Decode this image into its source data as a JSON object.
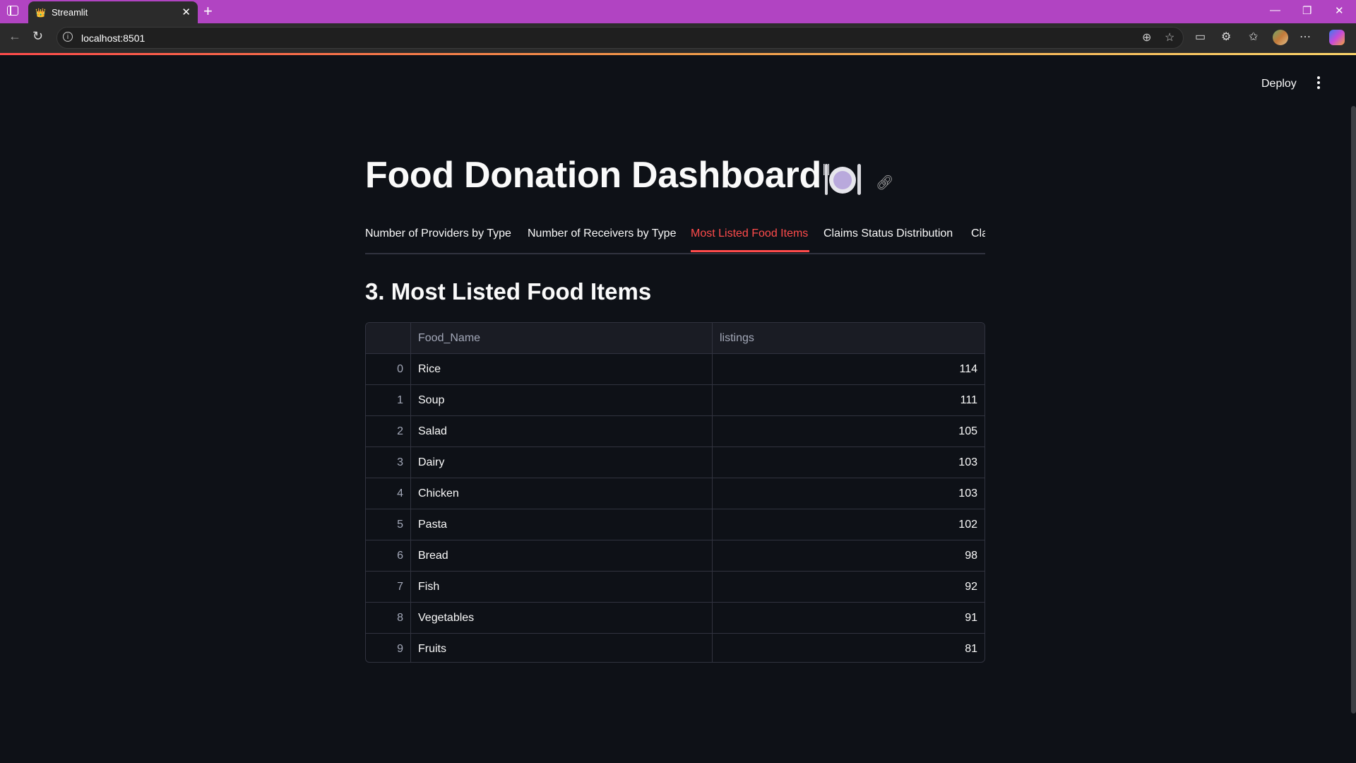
{
  "browser": {
    "tab_title": "Streamlit",
    "address": "localhost:8501"
  },
  "app": {
    "deploy_label": "Deploy",
    "title": "Food Donation Dashboard",
    "title_emoji": "🍽️",
    "tabs": [
      {
        "label": "Number of Providers by Type"
      },
      {
        "label": "Number of Receivers by Type"
      },
      {
        "label": "Most Listed Food Items",
        "active": true
      },
      {
        "label": "Claims Status Distribution"
      },
      {
        "label": "Cla"
      }
    ],
    "section_heading": "3. Most Listed Food Items",
    "table": {
      "columns": [
        "Food_Name",
        "listings"
      ],
      "rows": [
        {
          "index": "0",
          "name": "Rice",
          "listings": "114"
        },
        {
          "index": "1",
          "name": "Soup",
          "listings": "111"
        },
        {
          "index": "2",
          "name": "Salad",
          "listings": "105"
        },
        {
          "index": "3",
          "name": "Dairy",
          "listings": "103"
        },
        {
          "index": "4",
          "name": "Chicken",
          "listings": "103"
        },
        {
          "index": "5",
          "name": "Pasta",
          "listings": "102"
        },
        {
          "index": "6",
          "name": "Bread",
          "listings": "98"
        },
        {
          "index": "7",
          "name": "Fish",
          "listings": "92"
        },
        {
          "index": "8",
          "name": "Vegetables",
          "listings": "91"
        },
        {
          "index": "9",
          "name": "Fruits",
          "listings": "81"
        }
      ]
    }
  },
  "colors": {
    "tabbar": "#b144c2",
    "background": "#0e1117",
    "accent": "#ff4b4b"
  }
}
